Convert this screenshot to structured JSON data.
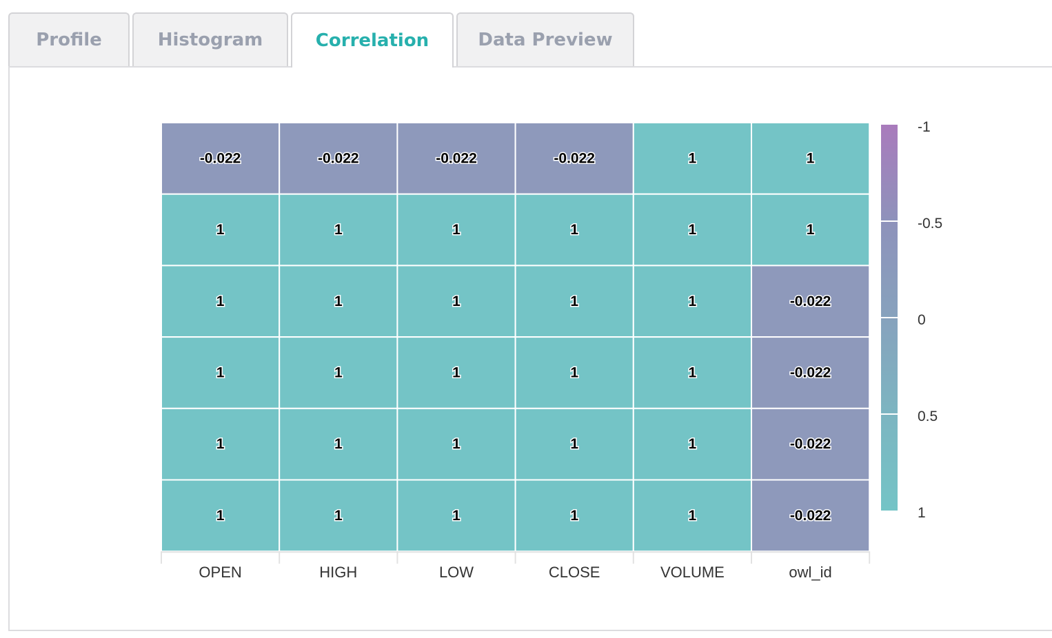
{
  "tabs": [
    {
      "label": "Profile",
      "active": false
    },
    {
      "label": "Histogram",
      "active": false
    },
    {
      "label": "Correlation",
      "active": true
    },
    {
      "label": "Data Preview",
      "active": false
    }
  ],
  "colors": {
    "tab_active": "#27b0ad",
    "tab_inactive": "#9aa0ae",
    "positive": "#74c4c6",
    "near_zero": "#8e99bb",
    "negative": "#a97bbc"
  },
  "chart_data": {
    "type": "heatmap",
    "columns": [
      "OPEN",
      "HIGH",
      "LOW",
      "CLOSE",
      "VOLUME",
      "owl_id"
    ],
    "rows": [
      [
        -0.022,
        -0.022,
        -0.022,
        -0.022,
        1,
        1
      ],
      [
        1,
        1,
        1,
        1,
        1,
        1
      ],
      [
        1,
        1,
        1,
        1,
        1,
        -0.022
      ],
      [
        1,
        1,
        1,
        1,
        1,
        -0.022
      ],
      [
        1,
        1,
        1,
        1,
        1,
        -0.022
      ],
      [
        1,
        1,
        1,
        1,
        1,
        -0.022
      ]
    ],
    "cell_labels": [
      [
        "-0.022",
        "-0.022",
        "-0.022",
        "-0.022",
        "1",
        "1"
      ],
      [
        "1",
        "1",
        "1",
        "1",
        "1",
        "1"
      ],
      [
        "1",
        "1",
        "1",
        "1",
        "1",
        "-0.022"
      ],
      [
        "1",
        "1",
        "1",
        "1",
        "1",
        "-0.022"
      ],
      [
        "1",
        "1",
        "1",
        "1",
        "1",
        "-0.022"
      ],
      [
        "1",
        "1",
        "1",
        "1",
        "1",
        "-0.022"
      ]
    ],
    "color_scale": {
      "ticks": [
        "-1",
        "-0.5",
        "0",
        "0.5",
        "1"
      ],
      "range": [
        -1,
        1
      ],
      "stops": [
        "#a97bbc",
        "#8e92bb",
        "#87a2bd",
        "#7cb5c1",
        "#74c4c6"
      ]
    }
  }
}
